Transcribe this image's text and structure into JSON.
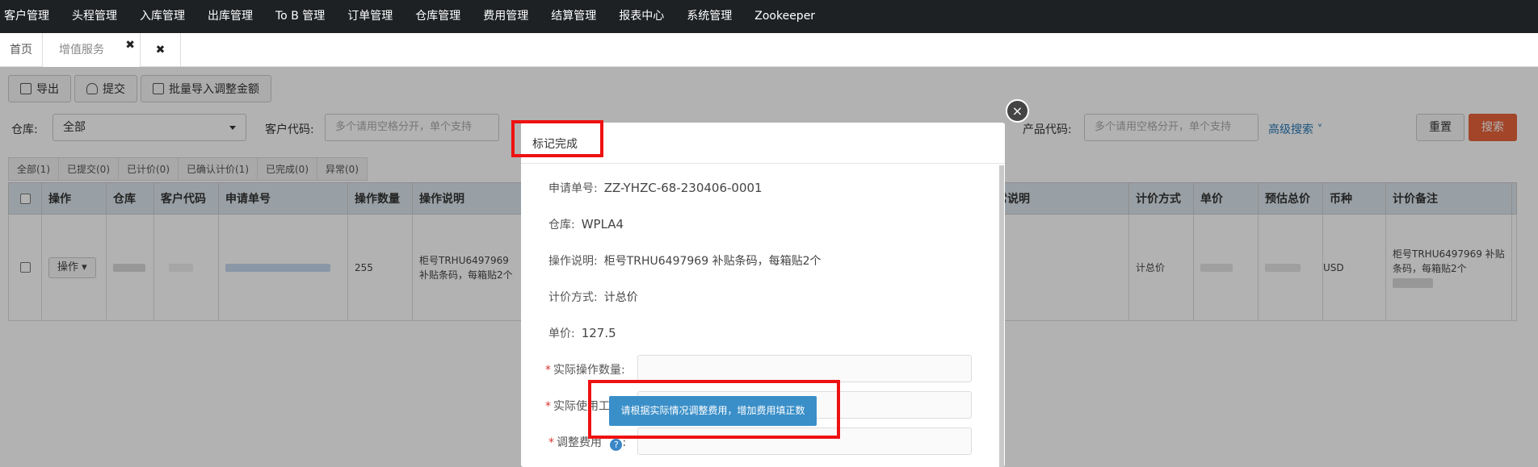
{
  "topnav": {
    "items": [
      "客户管理",
      "头程管理",
      "入库管理",
      "出库管理",
      "To B 管理",
      "订单管理",
      "仓库管理",
      "费用管理",
      "结算管理",
      "报表中心",
      "系统管理",
      "Zookeeper"
    ]
  },
  "tabs": {
    "home": "首页",
    "active": "增值服务",
    "close_glyph": "✖"
  },
  "toolbar": {
    "export": "导出",
    "submit": "提交",
    "batch_import": "批量导入调整金额"
  },
  "filters": {
    "warehouse_label": "仓库:",
    "warehouse_value": "全部",
    "customer_code_label": "客户代码:",
    "customer_code_placeholder": "多个请用空格分开，单个支持",
    "product_code_label": "产品代码:",
    "product_code_placeholder": "多个请用空格分开，单个支持",
    "advanced_search": "高级搜索",
    "reset": "重置",
    "search": "搜索"
  },
  "status_tabs": [
    "全部(1)",
    "已提交(0)",
    "已计价(0)",
    "已确认计价(1)",
    "已完成(0)",
    "异常(0)"
  ],
  "table": {
    "headers": [
      "操作",
      "仓库",
      "客户代码",
      "申请单号",
      "操作数量",
      "操作说明",
      "常说明",
      "计价方式",
      "单价",
      "预估总价",
      "币种",
      "计价备注"
    ],
    "row": {
      "op_button": "操作",
      "quantity": "255",
      "op_desc_1": "柜号TRHU6497969",
      "op_desc_2": "补贴条码，每箱贴2个",
      "pricing_method": "计总价",
      "currency": "USD",
      "remark_1": "柜号TRHU6497969 补贴",
      "remark_2": "条码，每箱贴2个"
    }
  },
  "modal": {
    "title": "标记完成",
    "request_no_label": "申请单号:",
    "request_no": "ZZ-YHZC-68-230406-0001",
    "warehouse_label": "仓库:",
    "warehouse": "WPLA4",
    "op_desc_label": "操作说明:",
    "op_desc": "柜号TRHU6497969 补贴条码，每箱贴2个",
    "pricing_method_label": "计价方式:",
    "pricing_method": "计总价",
    "unit_price_label": "单价:",
    "unit_price": "127.5",
    "actual_qty_label": "实际操作数量:",
    "actual_tool_label": "实际使用工",
    "adjust_fee_label": "调整费用",
    "required_mark": "*",
    "help_glyph": "?",
    "colon": ":",
    "tooltip": "请根据实际情况调整费用，增加费用填正数",
    "close_glyph": "×"
  },
  "colors": {
    "nav_bg": "#1e2124",
    "search_btn": "#e8633c",
    "highlight": "#ee1111",
    "tooltip_bg": "#3a8fc8"
  }
}
